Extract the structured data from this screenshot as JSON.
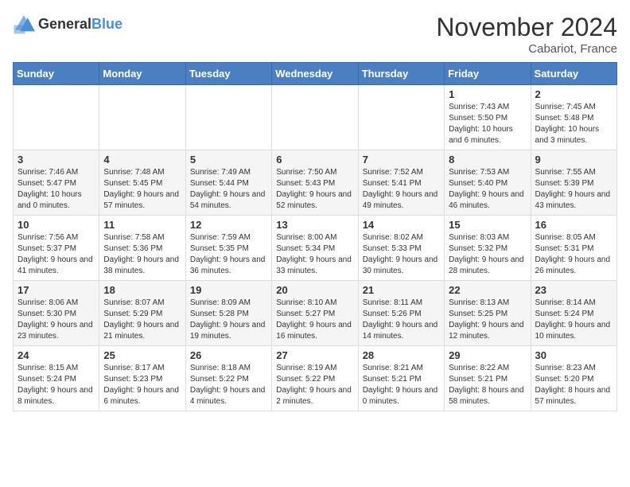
{
  "logo": {
    "text_general": "General",
    "text_blue": "Blue"
  },
  "header": {
    "month_year": "November 2024",
    "location": "Cabariot, France"
  },
  "weekdays": [
    "Sunday",
    "Monday",
    "Tuesday",
    "Wednesday",
    "Thursday",
    "Friday",
    "Saturday"
  ],
  "weeks": [
    [
      {
        "day": "",
        "info": ""
      },
      {
        "day": "",
        "info": ""
      },
      {
        "day": "",
        "info": ""
      },
      {
        "day": "",
        "info": ""
      },
      {
        "day": "",
        "info": ""
      },
      {
        "day": "1",
        "info": "Sunrise: 7:43 AM\nSunset: 5:50 PM\nDaylight: 10 hours and 6 minutes."
      },
      {
        "day": "2",
        "info": "Sunrise: 7:45 AM\nSunset: 5:48 PM\nDaylight: 10 hours and 3 minutes."
      }
    ],
    [
      {
        "day": "3",
        "info": "Sunrise: 7:46 AM\nSunset: 5:47 PM\nDaylight: 10 hours and 0 minutes."
      },
      {
        "day": "4",
        "info": "Sunrise: 7:48 AM\nSunset: 5:45 PM\nDaylight: 9 hours and 57 minutes."
      },
      {
        "day": "5",
        "info": "Sunrise: 7:49 AM\nSunset: 5:44 PM\nDaylight: 9 hours and 54 minutes."
      },
      {
        "day": "6",
        "info": "Sunrise: 7:50 AM\nSunset: 5:43 PM\nDaylight: 9 hours and 52 minutes."
      },
      {
        "day": "7",
        "info": "Sunrise: 7:52 AM\nSunset: 5:41 PM\nDaylight: 9 hours and 49 minutes."
      },
      {
        "day": "8",
        "info": "Sunrise: 7:53 AM\nSunset: 5:40 PM\nDaylight: 9 hours and 46 minutes."
      },
      {
        "day": "9",
        "info": "Sunrise: 7:55 AM\nSunset: 5:39 PM\nDaylight: 9 hours and 43 minutes."
      }
    ],
    [
      {
        "day": "10",
        "info": "Sunrise: 7:56 AM\nSunset: 5:37 PM\nDaylight: 9 hours and 41 minutes."
      },
      {
        "day": "11",
        "info": "Sunrise: 7:58 AM\nSunset: 5:36 PM\nDaylight: 9 hours and 38 minutes."
      },
      {
        "day": "12",
        "info": "Sunrise: 7:59 AM\nSunset: 5:35 PM\nDaylight: 9 hours and 36 minutes."
      },
      {
        "day": "13",
        "info": "Sunrise: 8:00 AM\nSunset: 5:34 PM\nDaylight: 9 hours and 33 minutes."
      },
      {
        "day": "14",
        "info": "Sunrise: 8:02 AM\nSunset: 5:33 PM\nDaylight: 9 hours and 30 minutes."
      },
      {
        "day": "15",
        "info": "Sunrise: 8:03 AM\nSunset: 5:32 PM\nDaylight: 9 hours and 28 minutes."
      },
      {
        "day": "16",
        "info": "Sunrise: 8:05 AM\nSunset: 5:31 PM\nDaylight: 9 hours and 26 minutes."
      }
    ],
    [
      {
        "day": "17",
        "info": "Sunrise: 8:06 AM\nSunset: 5:30 PM\nDaylight: 9 hours and 23 minutes."
      },
      {
        "day": "18",
        "info": "Sunrise: 8:07 AM\nSunset: 5:29 PM\nDaylight: 9 hours and 21 minutes."
      },
      {
        "day": "19",
        "info": "Sunrise: 8:09 AM\nSunset: 5:28 PM\nDaylight: 9 hours and 19 minutes."
      },
      {
        "day": "20",
        "info": "Sunrise: 8:10 AM\nSunset: 5:27 PM\nDaylight: 9 hours and 16 minutes."
      },
      {
        "day": "21",
        "info": "Sunrise: 8:11 AM\nSunset: 5:26 PM\nDaylight: 9 hours and 14 minutes."
      },
      {
        "day": "22",
        "info": "Sunrise: 8:13 AM\nSunset: 5:25 PM\nDaylight: 9 hours and 12 minutes."
      },
      {
        "day": "23",
        "info": "Sunrise: 8:14 AM\nSunset: 5:24 PM\nDaylight: 9 hours and 10 minutes."
      }
    ],
    [
      {
        "day": "24",
        "info": "Sunrise: 8:15 AM\nSunset: 5:24 PM\nDaylight: 9 hours and 8 minutes."
      },
      {
        "day": "25",
        "info": "Sunrise: 8:17 AM\nSunset: 5:23 PM\nDaylight: 9 hours and 6 minutes."
      },
      {
        "day": "26",
        "info": "Sunrise: 8:18 AM\nSunset: 5:22 PM\nDaylight: 9 hours and 4 minutes."
      },
      {
        "day": "27",
        "info": "Sunrise: 8:19 AM\nSunset: 5:22 PM\nDaylight: 9 hours and 2 minutes."
      },
      {
        "day": "28",
        "info": "Sunrise: 8:21 AM\nSunset: 5:21 PM\nDaylight: 9 hours and 0 minutes."
      },
      {
        "day": "29",
        "info": "Sunrise: 8:22 AM\nSunset: 5:21 PM\nDaylight: 8 hours and 58 minutes."
      },
      {
        "day": "30",
        "info": "Sunrise: 8:23 AM\nSunset: 5:20 PM\nDaylight: 8 hours and 57 minutes."
      }
    ]
  ]
}
